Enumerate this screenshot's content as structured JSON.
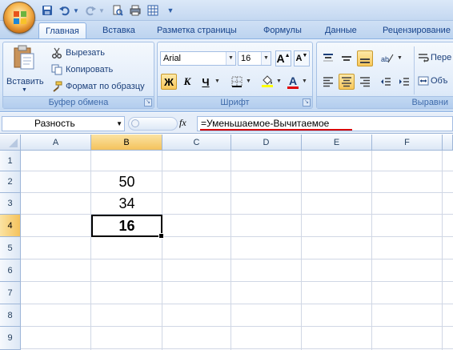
{
  "ribbon": {
    "tabs": [
      "Главная",
      "Вставка",
      "Разметка страницы",
      "Формулы",
      "Данные",
      "Рецензирование"
    ],
    "clipboard": {
      "paste_label": "Вставить",
      "cut_label": "Вырезать",
      "copy_label": "Копировать",
      "format_painter_label": "Формат по образцу",
      "group_label": "Буфер обмена"
    },
    "font": {
      "font_name": "Arial",
      "font_size": "16",
      "bold_label": "Ж",
      "italic_label": "К",
      "underline_label": "Ч",
      "font_color_label": "A",
      "grow_label": "A",
      "shrink_label": "A",
      "group_label": "Шрифт",
      "font_color_hex": "#e00000",
      "fill_color_hex": "#ffff00"
    },
    "alignment": {
      "wrap_label": "Пере",
      "merge_label": "Объ",
      "group_label": "Выравни"
    }
  },
  "formula_bar": {
    "name_box": "Разность",
    "fx_label": "fx",
    "formula": "=Уменьшаемое-Вычитаемое"
  },
  "sheet": {
    "columns": [
      "A",
      "B",
      "C",
      "D",
      "E",
      "F"
    ],
    "rows": [
      "1",
      "2",
      "3",
      "4",
      "5",
      "6",
      "7",
      "8",
      "9"
    ],
    "selected_column": "B",
    "selected_row": "4",
    "cells": {
      "B2": "50",
      "B3": "34",
      "B4": "16"
    }
  }
}
